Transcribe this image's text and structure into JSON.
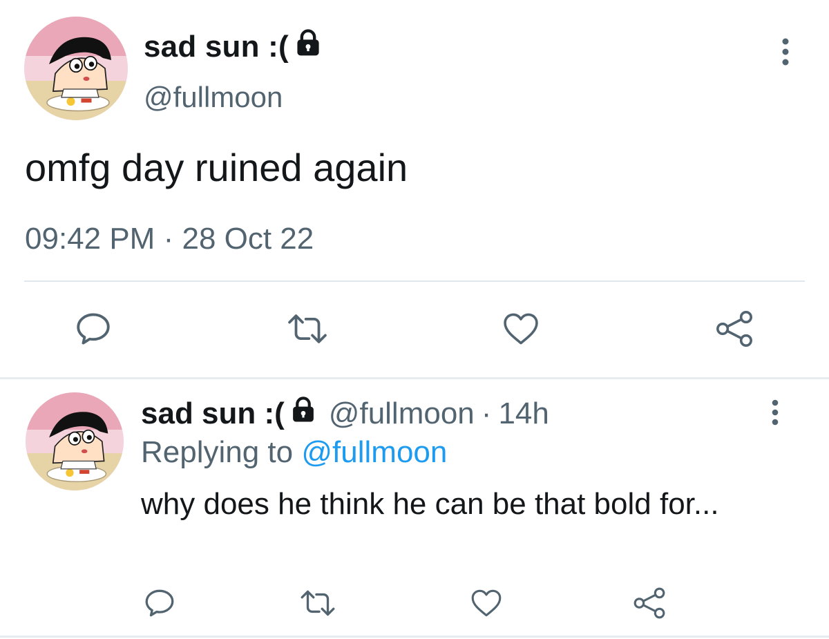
{
  "main_tweet": {
    "display_name": "sad sun :(",
    "handle": "@fullmoon",
    "text": "omfg day ruined again",
    "time": "09:42 PM",
    "dot": "·",
    "date": "28 Oct 22",
    "icons": {
      "lock": "lock-icon",
      "more": "more-vertical-icon",
      "reply": "reply-icon",
      "retweet": "retweet-icon",
      "like": "heart-icon",
      "share": "share-icon"
    }
  },
  "reply_tweet": {
    "display_name": "sad sun :(",
    "handle": "@fullmoon",
    "dot": "·",
    "time": "14h",
    "replying_to_label": "Replying to",
    "replying_to_handle": "@fullmoon",
    "text": "why does he think he can be that bold for..."
  },
  "colors": {
    "text": "#14171a",
    "secondary": "#536471",
    "link": "#1d9bf0",
    "icon": "#657786",
    "divider": "#e1e8ed"
  }
}
